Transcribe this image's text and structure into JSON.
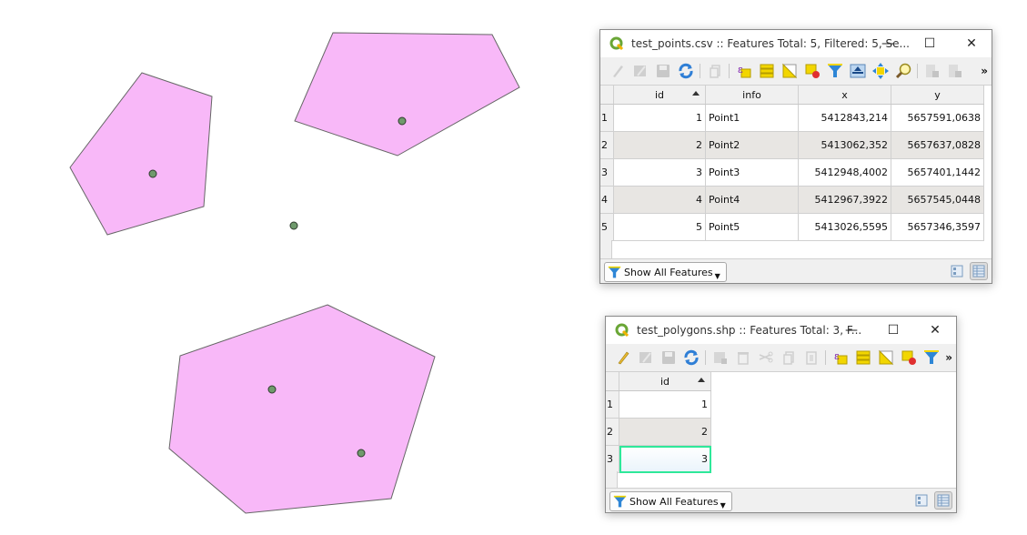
{
  "colors": {
    "polygon_fill": "#f8b8f8",
    "polygon_stroke": "#666666",
    "point_fill": "#6f9a6c",
    "point_stroke": "#2e3b2d",
    "selection_outline": "#2fe89a",
    "alt_row": "#e8e6e3"
  },
  "map": {
    "layers": [
      {
        "name": "test_polygons",
        "type": "polygon",
        "feature_count": 3
      },
      {
        "name": "test_points",
        "type": "point",
        "feature_count": 5
      }
    ]
  },
  "points_window": {
    "title": "test_points.csv :: Features Total: 5, Filtered: 5, Se...",
    "controls": {
      "minimize": "—",
      "maximize": "☐",
      "close": "✕"
    },
    "toolbar_icons": [
      "edit-pencil-icon",
      "multi-edit-icon",
      "save-icon",
      "reload-icon",
      "separator",
      "copy-icon",
      "separator",
      "select-by-expression-icon",
      "select-all-icon",
      "invert-selection-icon",
      "deselect-icon",
      "filter-icon",
      "move-selection-top-icon",
      "pan-to-selected-icon",
      "zoom-to-selected-icon",
      "separator",
      "new-field-icon",
      "delete-field-icon"
    ],
    "more_label": "»",
    "columns": [
      "id",
      "info",
      "x",
      "y"
    ],
    "sorted_column": "id",
    "rows": [
      {
        "row_header": "1",
        "id": "1",
        "info": "Point1",
        "x": "5412843,214",
        "y": "5657591,0638"
      },
      {
        "row_header": "2",
        "id": "2",
        "info": "Point2",
        "x": "5413062,352",
        "y": "5657637,0828"
      },
      {
        "row_header": "3",
        "id": "3",
        "info": "Point3",
        "x": "5412948,4002",
        "y": "5657401,1442"
      },
      {
        "row_header": "4",
        "id": "4",
        "info": "Point4",
        "x": "5412967,3922",
        "y": "5657545,0448"
      },
      {
        "row_header": "5",
        "id": "5",
        "info": "Point5",
        "x": "5413026,5595",
        "y": "5657346,3597"
      }
    ],
    "show_all_label": "Show All Features",
    "view_mode": "table"
  },
  "polygons_window": {
    "title": "test_polygons.shp :: Features Total: 3, F...",
    "controls": {
      "minimize": "—",
      "maximize": "☐",
      "close": "✕"
    },
    "more_label": "»",
    "columns": [
      "id"
    ],
    "sorted_column": "id",
    "rows": [
      {
        "row_header": "1",
        "id": "1"
      },
      {
        "row_header": "2",
        "id": "2"
      },
      {
        "row_header": "3",
        "id": "3"
      }
    ],
    "selected_row": 3,
    "show_all_label": "Show All Features",
    "view_mode": "table"
  }
}
